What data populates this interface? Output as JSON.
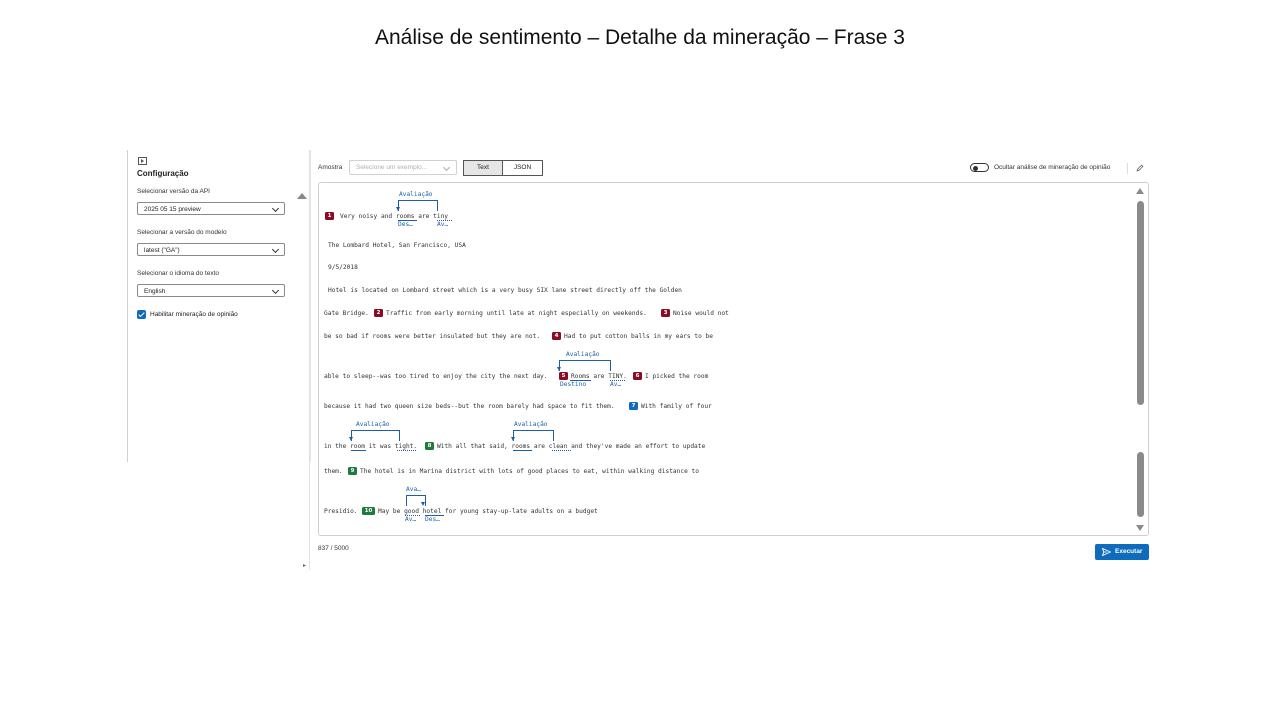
{
  "slide": {
    "title": "Análise de sentimento – Detalhe da mineração – Frase 3"
  },
  "config": {
    "heading": "Configuração",
    "api_version_label": "Selecionar versão da API",
    "api_version_value": "2025 05 15 preview",
    "model_version_label": "Selecionar a versão do modelo",
    "model_version_value": "latest (\"GA\")",
    "language_label": "Selecionar o idioma do texto",
    "language_value": "English",
    "opinion_mining_label": "Habilitar mineração de opinião",
    "opinion_mining_checked": true
  },
  "toolbar": {
    "sample_label": "Amostra",
    "sample_placeholder": "Selecione um exemplo...",
    "text_tab": "Text",
    "json_tab": "JSON",
    "hide_toggle_label": "Ocultar análise de mineração de opinião"
  },
  "colors": {
    "negative": "#8b0a25",
    "positive": "#1e7b3a",
    "neutral": "#0f6cbd",
    "accent": "#0f6cbd"
  },
  "text_panel": {
    "line1_text": "Very noisy and rooms are tiny",
    "line2_text": "The Lombard Hotel, San Francisco, USA",
    "line3_text": "9/5/2018",
    "line4_text": "Hotel is located on Lombard street which is a very busy SIX lane street directly off the Golden",
    "line5_a": "Gate Bridge.",
    "line5_b": "Traffic from early morning until late at night especially on weekends.",
    "line5_c": "Noise would not",
    "line6_a": "be so bad if rooms were better insulated but they are not.",
    "line6_b": "Had to put cotton balls in my ears to be",
    "line7_a": "able to sleep--was too tired to enjoy the city the next day.",
    "line7_b": "Rooms are TINY.",
    "line7_c": "I picked the room",
    "line8_a": "because it had two queen size beds--but the room barely had space to fit them.",
    "line8_b": "With family of four",
    "line9_a": "in the room it was tight.",
    "line9_b": "With all that said, rooms are clean and they've made an effort to update",
    "line10_a": "them.",
    "line10_b": "The hotel is in Marina district with lots of good places to eat, within walking distance to",
    "line11_a": "Presidio.",
    "line11_b": "May be good hotel for young stay-up-late adults on a budget",
    "badges": [
      "1",
      "2",
      "3",
      "4",
      "5",
      "6",
      "7",
      "8",
      "9",
      "10"
    ],
    "ann_avaliacao": "Avaliação",
    "ann_des_short": "Des…",
    "ann_av_short": "Av…",
    "ann_ava_short": "Ava…",
    "ann_destino": "Destino"
  },
  "footer": {
    "char_count": "837 / 5000",
    "run_label": "Executar"
  }
}
